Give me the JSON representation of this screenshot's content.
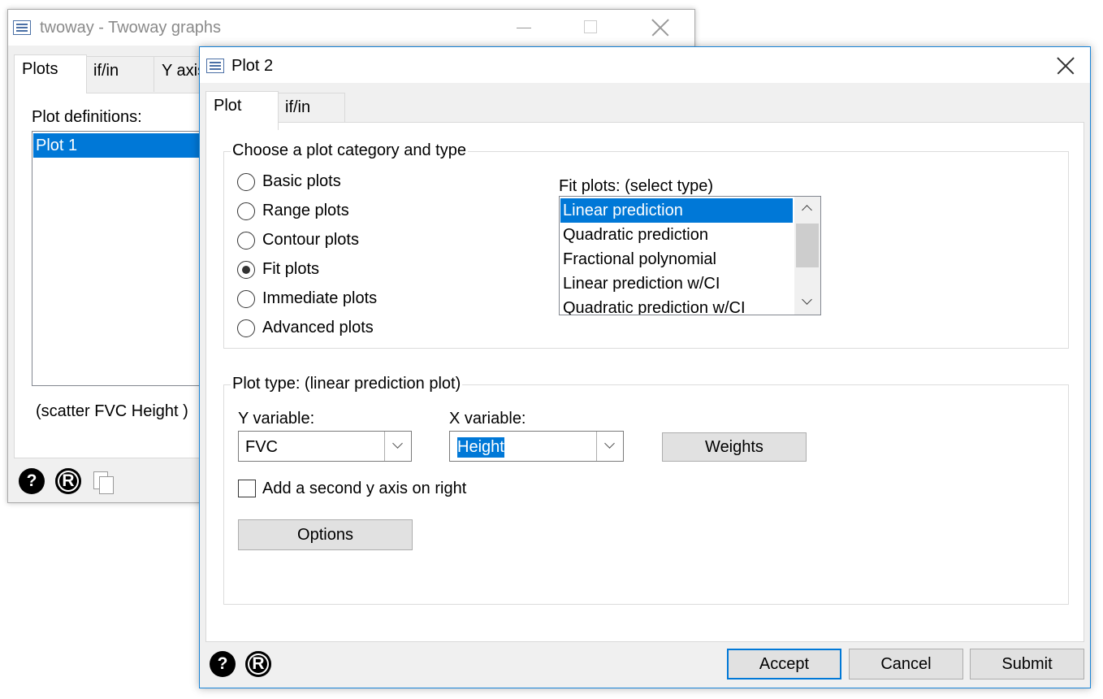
{
  "back_window": {
    "title": "twoway - Twoway graphs",
    "tabs": [
      {
        "label": "Plots"
      },
      {
        "label": "if/in"
      },
      {
        "label": "Y axis"
      }
    ],
    "plot_definitions_label": "Plot definitions:",
    "plot_list": [
      "Plot 1"
    ],
    "command_preview": "(scatter FVC Height )",
    "footer_icons": [
      "help-icon",
      "reset-icon",
      "copy-icon"
    ]
  },
  "front_window": {
    "title": "Plot 2",
    "tabs": [
      {
        "label": "Plot"
      },
      {
        "label": "if/in"
      }
    ],
    "category_group": {
      "legend": "Choose a plot category and type",
      "options": [
        {
          "label": "Basic plots",
          "selected": false
        },
        {
          "label": "Range plots",
          "selected": false
        },
        {
          "label": "Contour plots",
          "selected": false
        },
        {
          "label": "Fit plots",
          "selected": true
        },
        {
          "label": "Immediate plots",
          "selected": false
        },
        {
          "label": "Advanced plots",
          "selected": false
        }
      ],
      "fit_list_label": "Fit plots: (select type)",
      "fit_list": [
        "Linear prediction",
        "Quadratic prediction",
        "Fractional polynomial",
        "Linear prediction w/CI",
        "Quadratic prediction w/CI"
      ],
      "fit_selected_index": 0
    },
    "plot_type_group": {
      "legend": "Plot type: (linear prediction plot)",
      "y_label": "Y variable:",
      "y_value": "FVC",
      "x_label": "X variable:",
      "x_value": "Height",
      "weights_label": "Weights",
      "second_axis_label": "Add a second y axis on right",
      "second_axis_checked": false,
      "options_label": "Options"
    },
    "buttons": {
      "accept": "Accept",
      "cancel": "Cancel",
      "submit": "Submit"
    },
    "footer_icons": [
      "help-icon",
      "reset-icon"
    ]
  },
  "colors": {
    "selection": "#0078d7",
    "window_bg": "#f0f0f0",
    "accent_border": "#0078d7"
  }
}
